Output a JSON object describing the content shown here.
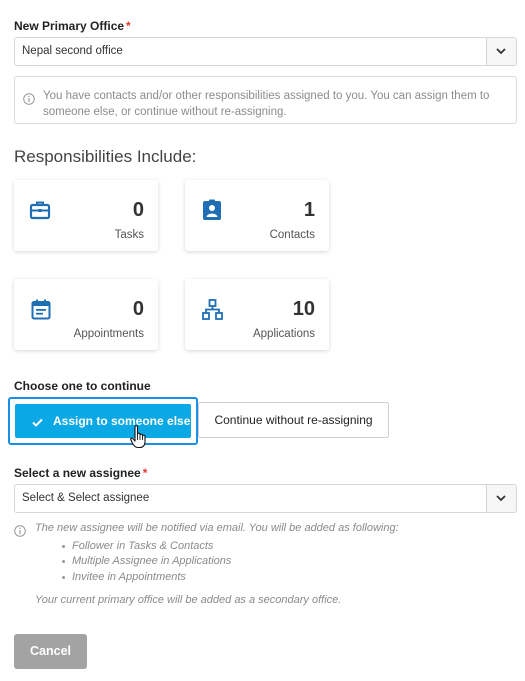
{
  "primary_office": {
    "label": "New Primary Office",
    "required_mark": "*",
    "value": "Nepal second office"
  },
  "info_message": "You have contacts and/or other responsibilities assigned to you. You can assign them to someone else, or continue without re-assigning.",
  "responsibilities": {
    "title": "Responsibilities Include:",
    "cards": [
      {
        "icon": "briefcase-icon",
        "count": "0",
        "label": "Tasks"
      },
      {
        "icon": "contact-badge-icon",
        "count": "1",
        "label": "Contacts"
      },
      {
        "icon": "calendar-icon",
        "count": "0",
        "label": "Appointments"
      },
      {
        "icon": "workflow-icon",
        "count": "10",
        "label": "Applications"
      }
    ]
  },
  "choice": {
    "label": "Choose one to continue",
    "assign_label": "Assign to someone else",
    "continue_label": "Continue without re-assigning",
    "selected": "assign"
  },
  "assignee": {
    "label": "Select a new assignee",
    "required_mark": "*",
    "placeholder": "Select & Select assignee"
  },
  "note": {
    "intro": "The new assignee will be notified via email. You will be added as following:",
    "items": [
      "Follower in Tasks & Contacts",
      "Multiple Assignee in Applications",
      "Invitee in Appointments"
    ],
    "secondary": "Your current primary office will be added as a secondary office."
  },
  "cancel_label": "Cancel",
  "colors": {
    "accent": "#0ba8e6",
    "icon_blue": "#1f6fb5",
    "required": "#e53935",
    "cancel_bg": "#a3a3a3"
  }
}
